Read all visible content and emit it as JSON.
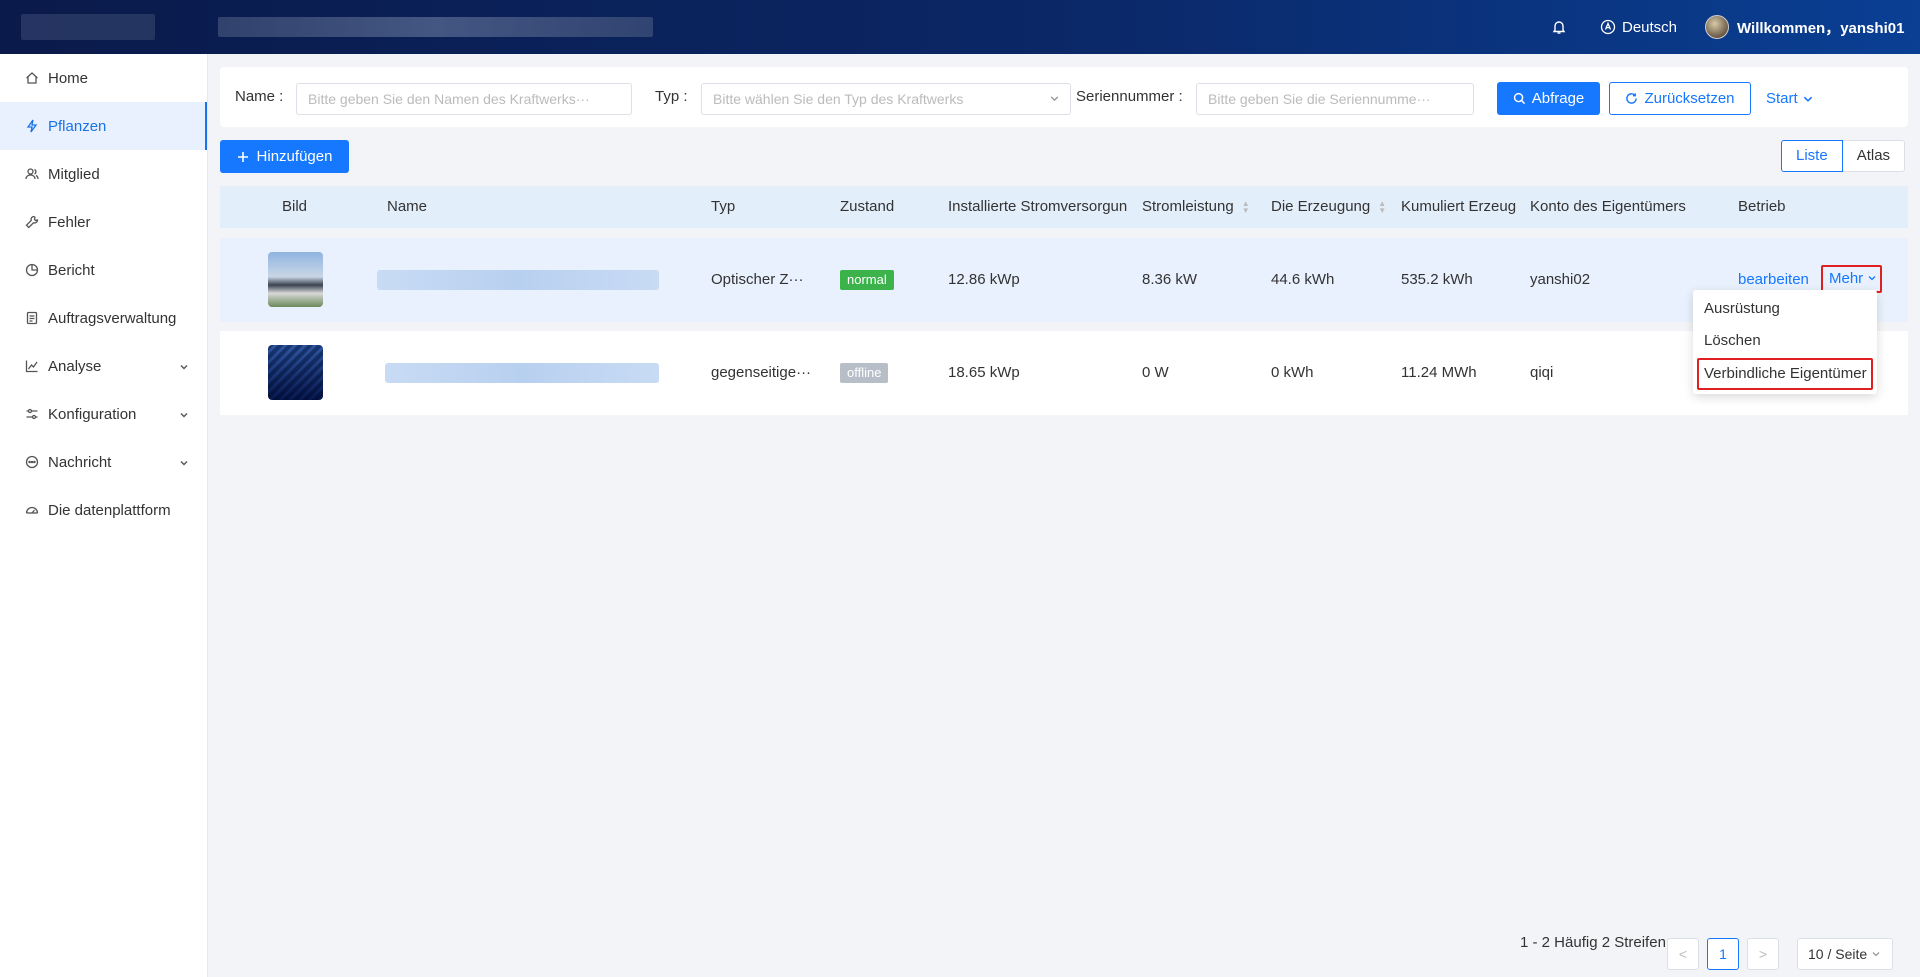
{
  "header": {
    "language": "Deutsch",
    "welcome": "Willkommen，yanshi01"
  },
  "sidebar": {
    "items": [
      {
        "label": "Home",
        "icon": "home-icon"
      },
      {
        "label": "Pflanzen",
        "icon": "lightning-icon",
        "active": true
      },
      {
        "label": "Mitglied",
        "icon": "users-icon"
      },
      {
        "label": "Fehler",
        "icon": "wrench-icon"
      },
      {
        "label": "Bericht",
        "icon": "pie-chart-icon"
      },
      {
        "label": "Auftragsverwaltung",
        "icon": "clipboard-icon"
      },
      {
        "label": "Analyse",
        "icon": "line-chart-icon",
        "expandable": true
      },
      {
        "label": "Konfiguration",
        "icon": "sliders-icon",
        "expandable": true
      },
      {
        "label": "Nachricht",
        "icon": "message-icon",
        "expandable": true
      },
      {
        "label": "Die datenplattform",
        "icon": "dashboard-icon"
      }
    ]
  },
  "filter": {
    "name_label": "Name :",
    "name_placeholder": "Bitte geben Sie den Namen des Kraftwerks···",
    "type_label": "Typ :",
    "type_placeholder": "Bitte wählen Sie den Typ des Kraftwerks",
    "serial_label": "Seriennummer :",
    "serial_placeholder": "Bitte geben Sie die Seriennumme···",
    "query_button": "Abfrage",
    "reset_button": "Zurücksetzen",
    "start_link": "Start"
  },
  "toolbar": {
    "add_button": "Hinzufügen",
    "view_list": "Liste",
    "view_atlas": "Atlas"
  },
  "table": {
    "columns": [
      "Bild",
      "Name",
      "Typ",
      "Zustand",
      "Installierte Stromversorgun",
      "Stromleistung",
      "Die Erzeugung",
      "Kumuliert Erzeug",
      "Konto des Eigentümers",
      "Betrieb"
    ],
    "rows": [
      {
        "type": "Optischer Z···",
        "status": "normal",
        "installed": "12.86 kWp",
        "power": "8.36 kW",
        "generation": "44.6 kWh",
        "cumulative": "535.2 kWh",
        "owner": "yanshi02",
        "edit": "bearbeiten",
        "more": "Mehr"
      },
      {
        "type": "gegenseitige···",
        "status": "offline",
        "installed": "18.65 kWp",
        "power": "0 W",
        "generation": "0 kWh",
        "cumulative": "11.24 MWh",
        "owner": "qiqi"
      }
    ]
  },
  "dropdown": {
    "items": [
      "Ausrüstung",
      "Löschen",
      "Verbindliche Eigentümer"
    ]
  },
  "pagination": {
    "summary": "1 - 2 Häufig 2 Streifen",
    "prev": "<",
    "current": "1",
    "next": ">",
    "page_size": "10 / Seite"
  },
  "colors": {
    "accent": "#1677ff",
    "status_normal": "#3cb34a",
    "status_offline": "#b8bec8",
    "highlight_box": "#e02020"
  }
}
